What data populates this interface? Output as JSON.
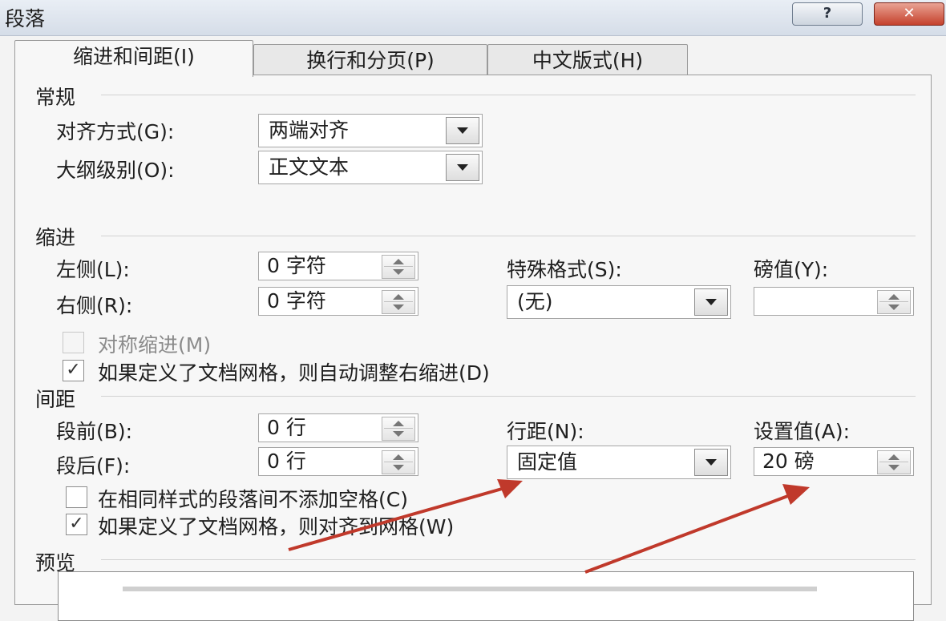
{
  "window": {
    "title": "段落",
    "help_label": "?",
    "close_label": "✕"
  },
  "tabs": [
    {
      "label": "缩进和间距(I)",
      "active": true
    },
    {
      "label": "换行和分页(P)",
      "active": false
    },
    {
      "label": "中文版式(H)",
      "active": false
    }
  ],
  "general": {
    "heading": "常规",
    "alignment": {
      "label": "对齐方式(G):",
      "value": "两端对齐"
    },
    "outline": {
      "label": "大纲级别(O):",
      "value": "正文文本"
    }
  },
  "indent": {
    "heading": "缩进",
    "left": {
      "label": "左侧(L):",
      "value": "0 字符"
    },
    "right": {
      "label": "右侧(R):",
      "value": "0 字符"
    },
    "special": {
      "label": "特殊格式(S):",
      "value": "(无)"
    },
    "by": {
      "label": "磅值(Y):",
      "value": ""
    },
    "mirror": {
      "label": "对称缩进(M)",
      "checked": false
    },
    "auto_adjust": {
      "label": "如果定义了文档网格，则自动调整右缩进(D)",
      "checked": true
    }
  },
  "spacing": {
    "heading": "间距",
    "before": {
      "label": "段前(B):",
      "value": "0 行"
    },
    "after": {
      "label": "段后(F):",
      "value": "0 行"
    },
    "line_spacing": {
      "label": "行距(N):",
      "value": "固定值"
    },
    "at": {
      "label": "设置值(A):",
      "value": "20 磅"
    },
    "no_space_same_style": {
      "label": "在相同样式的段落间不添加空格(C)",
      "checked": false
    },
    "snap_to_grid": {
      "label": "如果定义了文档网格，则对齐到网格(W)",
      "checked": true
    }
  },
  "preview": {
    "heading": "预览"
  },
  "colors": {
    "annotation_arrow": "#c0392b",
    "close_button": "#c5412c"
  },
  "icons": [
    "help-icon",
    "close-icon",
    "dropdown-arrow-icon",
    "spin-up-icon",
    "spin-down-icon",
    "checkmark-icon",
    "annotation-arrow-icon"
  ]
}
